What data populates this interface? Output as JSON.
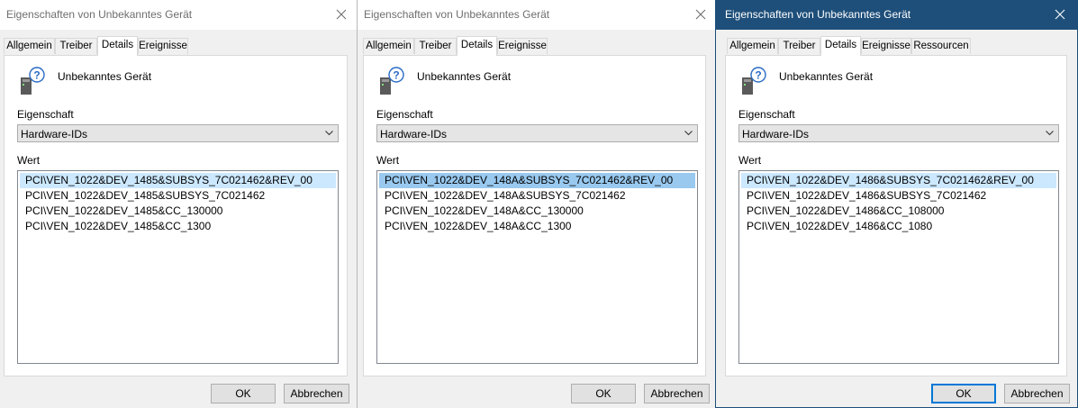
{
  "colors": {
    "active_titlebar": "#1e4f7a",
    "selection": "#cce8ff",
    "selection_focused": "#99c9ef",
    "default_button_border": "#0078d7"
  },
  "dialogs": [
    {
      "title": "Eigenschaften von Unbekanntes Gerät",
      "active": false,
      "tabs": [
        {
          "label": "Allgemein",
          "selected": false
        },
        {
          "label": "Treiber",
          "selected": false
        },
        {
          "label": "Details",
          "selected": true
        },
        {
          "label": "Ereignisse",
          "selected": false
        }
      ],
      "device_icon": "unknown-device-icon",
      "device_name": "Unbekanntes Gerät",
      "property_label": "Eigenschaft",
      "property_value": "Hardware-IDs",
      "value_label": "Wert",
      "values": [
        "PCI\\VEN_1022&DEV_1485&SUBSYS_7C021462&REV_00",
        "PCI\\VEN_1022&DEV_1485&SUBSYS_7C021462",
        "PCI\\VEN_1022&DEV_1485&CC_130000",
        "PCI\\VEN_1022&DEV_1485&CC_1300"
      ],
      "selected_value": 0,
      "ok_label": "OK",
      "cancel_label": "Abbrechen"
    },
    {
      "title": "Eigenschaften von Unbekanntes Gerät",
      "active": false,
      "tabs": [
        {
          "label": "Allgemein",
          "selected": false
        },
        {
          "label": "Treiber",
          "selected": false
        },
        {
          "label": "Details",
          "selected": true
        },
        {
          "label": "Ereignisse",
          "selected": false
        }
      ],
      "device_icon": "unknown-device-icon",
      "device_name": "Unbekanntes Gerät",
      "property_label": "Eigenschaft",
      "property_value": "Hardware-IDs",
      "value_label": "Wert",
      "values": [
        "PCI\\VEN_1022&DEV_148A&SUBSYS_7C021462&REV_00",
        "PCI\\VEN_1022&DEV_148A&SUBSYS_7C021462",
        "PCI\\VEN_1022&DEV_148A&CC_130000",
        "PCI\\VEN_1022&DEV_148A&CC_1300"
      ],
      "selected_value": 0,
      "ok_label": "OK",
      "cancel_label": "Abbrechen"
    },
    {
      "title": "Eigenschaften von Unbekanntes Gerät",
      "active": true,
      "tabs": [
        {
          "label": "Allgemein",
          "selected": false
        },
        {
          "label": "Treiber",
          "selected": false
        },
        {
          "label": "Details",
          "selected": true
        },
        {
          "label": "Ereignisse",
          "selected": false
        },
        {
          "label": "Ressourcen",
          "selected": false
        }
      ],
      "device_icon": "unknown-device-icon",
      "device_name": "Unbekanntes Gerät",
      "property_label": "Eigenschaft",
      "property_value": "Hardware-IDs",
      "value_label": "Wert",
      "values": [
        "PCI\\VEN_1022&DEV_1486&SUBSYS_7C021462&REV_00",
        "PCI\\VEN_1022&DEV_1486&SUBSYS_7C021462",
        "PCI\\VEN_1022&DEV_1486&CC_108000",
        "PCI\\VEN_1022&DEV_1486&CC_1080"
      ],
      "selected_value": 0,
      "ok_label": "OK",
      "cancel_label": "Abbrechen"
    }
  ]
}
